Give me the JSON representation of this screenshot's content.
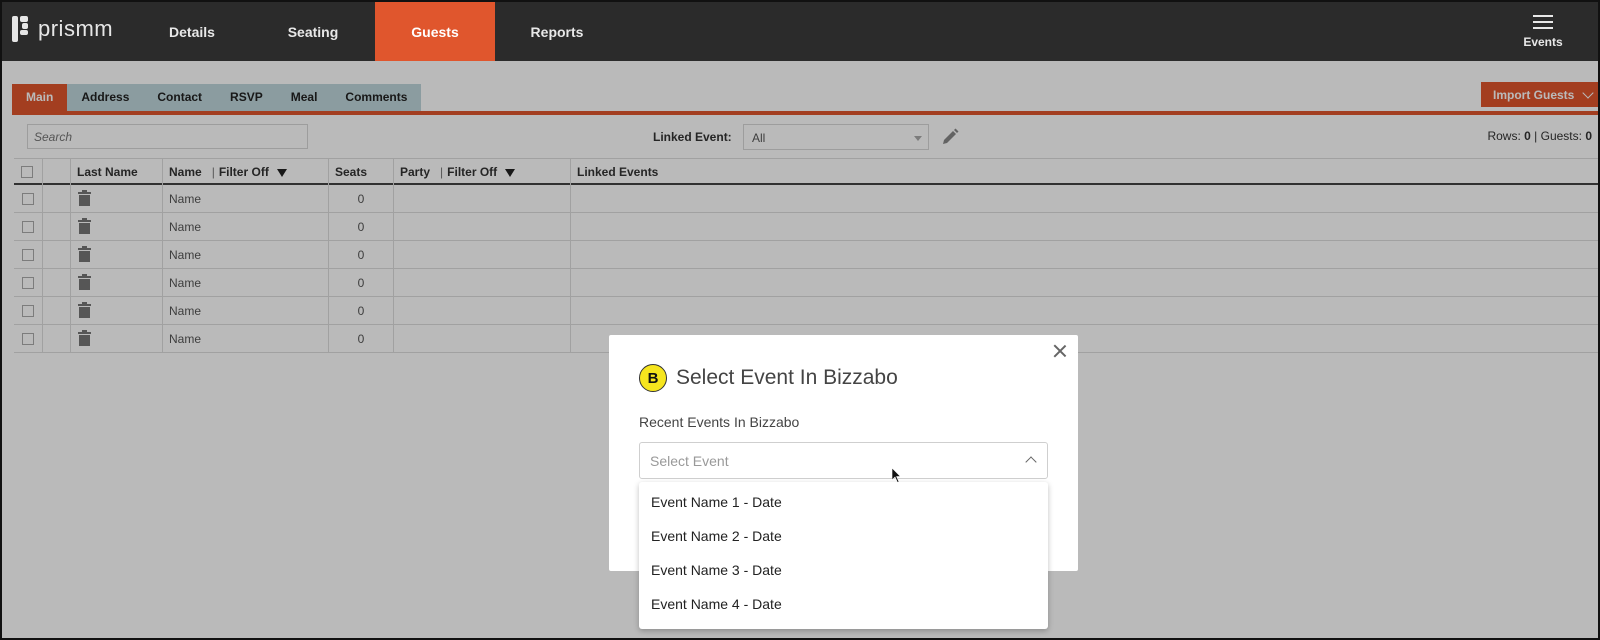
{
  "app": {
    "brand": "prismm",
    "nav_tabs": [
      {
        "label": "Details",
        "active": false
      },
      {
        "label": "Seating",
        "active": false
      },
      {
        "label": "Guests",
        "active": true
      },
      {
        "label": "Reports",
        "active": false
      }
    ],
    "menu_label": "Events",
    "accent_color": "#e0562d"
  },
  "subtabs": [
    "Main",
    "Address",
    "Contact",
    "RSVP",
    "Meal",
    "Comments"
  ],
  "import_button": "Import Guests",
  "toolbar": {
    "search_placeholder": "Search",
    "linked_event_label": "Linked Event:",
    "linked_event_value": "All",
    "rows_label": "Rows:",
    "rows_value": "0",
    "guests_label": "Guests:",
    "guests_value": "0"
  },
  "table": {
    "headers": {
      "last_name": "Last Name",
      "name": "Name",
      "name_filter": "Filter Off",
      "seats": "Seats",
      "party": "Party",
      "party_filter": "Filter Off",
      "linked_events": "Linked Events"
    },
    "rows": [
      {
        "name": "Name",
        "seats": "0"
      },
      {
        "name": "Name",
        "seats": "0"
      },
      {
        "name": "Name",
        "seats": "0"
      },
      {
        "name": "Name",
        "seats": "0"
      },
      {
        "name": "Name",
        "seats": "0"
      },
      {
        "name": "Name",
        "seats": "0"
      }
    ]
  },
  "modal": {
    "logo_letter": "B",
    "title": "Select Event In Bizzabo",
    "label": "Recent Events In Bizzabo",
    "select_placeholder": "Select Event",
    "options": [
      "Event Name 1 - Date",
      "Event Name 2 - Date",
      "Event Name 3 - Date",
      "Event Name 4 - Date"
    ]
  }
}
